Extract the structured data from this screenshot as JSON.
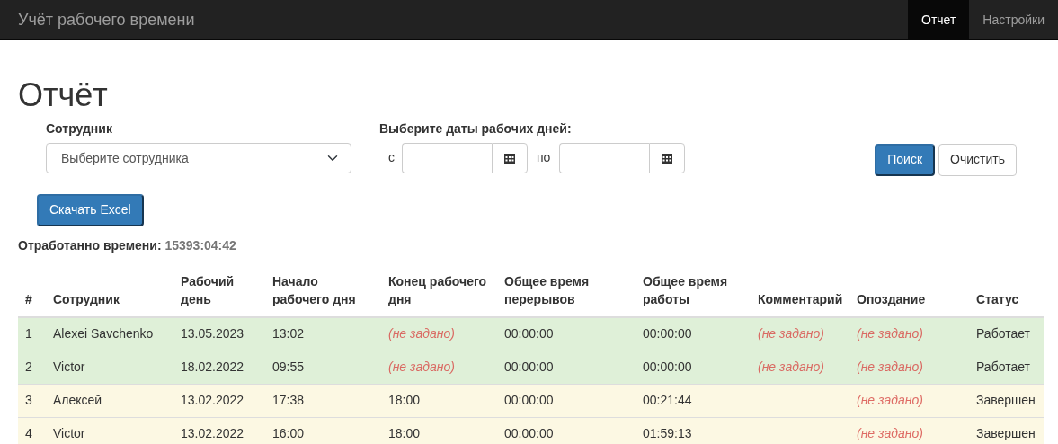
{
  "navbar": {
    "brand": "Учёт рабочего времени",
    "items": [
      {
        "label": "Отчет",
        "selected": true
      },
      {
        "label": "Настройки",
        "selected": false
      }
    ]
  },
  "page_title": "Отчёт",
  "filters": {
    "employee_label": "Сотрудник",
    "employee_placeholder": "Выберите сотрудника",
    "dates_label": "Выберите даты рабочих дней:",
    "from_label": "с",
    "to_label": "по",
    "search_button": "Поиск",
    "clear_button": "Очистить"
  },
  "download_button": "Скачать Excel",
  "worked_time": {
    "label": "Отработанно времени:",
    "value": "15393:04:42"
  },
  "table": {
    "columns": [
      "#",
      "Сотрудник",
      "Рабочий день",
      "Начало рабочего дня",
      "Конец рабочего дня",
      "Общее время перерывов",
      "Общее время работы",
      "Комментарий",
      "Опоздание",
      "Статус"
    ],
    "rows": [
      {
        "kind": "active",
        "cells": [
          {
            "text": "1",
            "unset": false
          },
          {
            "text": "Alexei Savchenko",
            "unset": false
          },
          {
            "text": "13.05.2023",
            "unset": false
          },
          {
            "text": "13:02",
            "unset": false
          },
          {
            "text": "(не задано)",
            "unset": true
          },
          {
            "text": "00:00:00",
            "unset": false
          },
          {
            "text": "00:00:00",
            "unset": false
          },
          {
            "text": "(не задано)",
            "unset": true
          },
          {
            "text": "(не задано)",
            "unset": true
          },
          {
            "text": "Работает",
            "unset": false
          }
        ]
      },
      {
        "kind": "active",
        "cells": [
          {
            "text": "2",
            "unset": false
          },
          {
            "text": "Victor",
            "unset": false
          },
          {
            "text": "18.02.2022",
            "unset": false
          },
          {
            "text": "09:55",
            "unset": false
          },
          {
            "text": "(не задано)",
            "unset": true
          },
          {
            "text": "00:00:00",
            "unset": false
          },
          {
            "text": "00:00:00",
            "unset": false
          },
          {
            "text": "(не задано)",
            "unset": true
          },
          {
            "text": "(не задано)",
            "unset": true
          },
          {
            "text": "Работает",
            "unset": false
          }
        ]
      },
      {
        "kind": "done",
        "cells": [
          {
            "text": "3",
            "unset": false
          },
          {
            "text": "Алексей",
            "unset": false
          },
          {
            "text": "13.02.2022",
            "unset": false
          },
          {
            "text": "17:38",
            "unset": false
          },
          {
            "text": "18:00",
            "unset": false
          },
          {
            "text": "00:00:00",
            "unset": false
          },
          {
            "text": "00:21:44",
            "unset": false
          },
          null,
          {
            "text": "(не задано)",
            "unset": true
          },
          {
            "text": "Завершен",
            "unset": false
          }
        ]
      },
      {
        "kind": "done",
        "cells": [
          {
            "text": "4",
            "unset": false
          },
          {
            "text": "Victor",
            "unset": false
          },
          {
            "text": "13.02.2022",
            "unset": false
          },
          {
            "text": "16:00",
            "unset": false
          },
          {
            "text": "18:00",
            "unset": false
          },
          {
            "text": "00:00:00",
            "unset": false
          },
          {
            "text": "01:59:13",
            "unset": false
          },
          null,
          {
            "text": "(не задано)",
            "unset": true
          },
          {
            "text": "Завершен",
            "unset": false
          }
        ]
      }
    ]
  }
}
